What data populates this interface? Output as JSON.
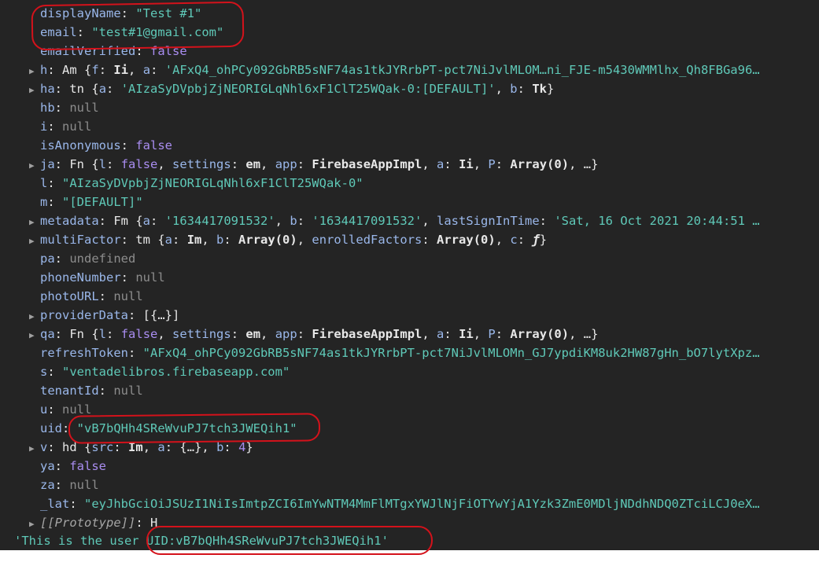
{
  "console": {
    "display_name_key": "displayName",
    "display_name_value": "\"Test #1\"",
    "email_key": "email",
    "email_value": "\"test#1@gmail.com\"",
    "email_verified_key": "emailVerified",
    "email_verified_value": "false",
    "h_key": "h",
    "h_type": "Am",
    "h_f": "Ii",
    "h_a": "'AFxQ4_ohPCy092GbRB5sNF74as1tkJYRrbPT-pct7NiJvlMLOM…ni_FJE-m5430WMMlhx_Qh8FBGa96…",
    "ha_key": "ha",
    "ha_type": "tn",
    "ha_a": "'AIzaSyDVpbjZjNEORIGLqNhl6xF1ClT25WQak-0:[DEFAULT]'",
    "ha_b": "Tk",
    "hb_key": "hb",
    "hb_value": "null",
    "i_key": "i",
    "i_value": "null",
    "is_anonymous_key": "isAnonymous",
    "is_anonymous_value": "false",
    "ja_key": "ja",
    "ja_type": "Fn",
    "ja_l": "false",
    "ja_settings": "em",
    "ja_app": "FirebaseAppImpl",
    "ja_a": "Ii",
    "ja_p": "Array(0)",
    "l_key": "l",
    "l_value": "\"AIzaSyDVpbjZjNEORIGLqNhl6xF1ClT25WQak-0\"",
    "m_key": "m",
    "m_value": "\"[DEFAULT]\"",
    "metadata_key": "metadata",
    "metadata_type": "Fm",
    "metadata_a": "'1634417091532'",
    "metadata_b": "'1634417091532'",
    "metadata_last_key": "lastSignInTime",
    "metadata_last": "'Sat, 16 Oct 2021 20:44:51 …",
    "multifactor_key": "multiFactor",
    "multifactor_type": "tm",
    "multifactor_a": "Im",
    "multifactor_b": "Array(0)",
    "multifactor_enrolled_key": "enrolledFactors",
    "multifactor_enrolled": "Array(0)",
    "multifactor_c": "ƒ",
    "pa_key": "pa",
    "pa_value": "undefined",
    "phone_key": "phoneNumber",
    "phone_value": "null",
    "photo_key": "photoURL",
    "photo_value": "null",
    "provider_key": "providerData",
    "provider_value": "[{…}]",
    "qa_key": "qa",
    "qa_type": "Fn",
    "qa_l": "false",
    "qa_settings": "em",
    "qa_app": "FirebaseAppImpl",
    "qa_a": "Ii",
    "qa_p": "Array(0)",
    "refresh_key": "refreshToken",
    "refresh_value": "\"AFxQ4_ohPCy092GbRB5sNF74as1tkJYRrbPT-pct7NiJvlMLOMn_GJ7ypdiKM8uk2HW87gHn_bO7lytXpz…",
    "s_key": "s",
    "s_value": "\"ventadelibros.firebaseapp.com\"",
    "tenant_key": "tenantId",
    "tenant_value": "null",
    "u_key": "u",
    "u_value": "null",
    "uid_key": "uid",
    "uid_value": "\"vB7bQHh4SReWvuPJ7tch3JWEQih1\"",
    "v_key": "v",
    "v_type": "hd",
    "v_src": "Im",
    "v_a": "{…}",
    "v_b": "4",
    "ya_key": "ya",
    "ya_value": "false",
    "za_key": "za",
    "za_value": "null",
    "lat_key": "_lat",
    "lat_value": "\"eyJhbGciOiJSUzI1NiIsImtpZCI6ImYwNTM4MmFlMTgxYWJlNjFiOTYwYjA1Yzk3ZmE0MDljNDdhNDQ0ZTciLCJ0eX…",
    "proto_key": "[[Prototype]]",
    "proto_value": "H",
    "log_line": "'This is the user UID:vB7bQHh4SReWvuPJ7tch3JWEQih1'"
  },
  "colors": {
    "background": "#242424",
    "key": "#9ab7ea",
    "string": "#5fc9b8",
    "keyword": "#a98df0",
    "annotation": "#d4121b"
  }
}
